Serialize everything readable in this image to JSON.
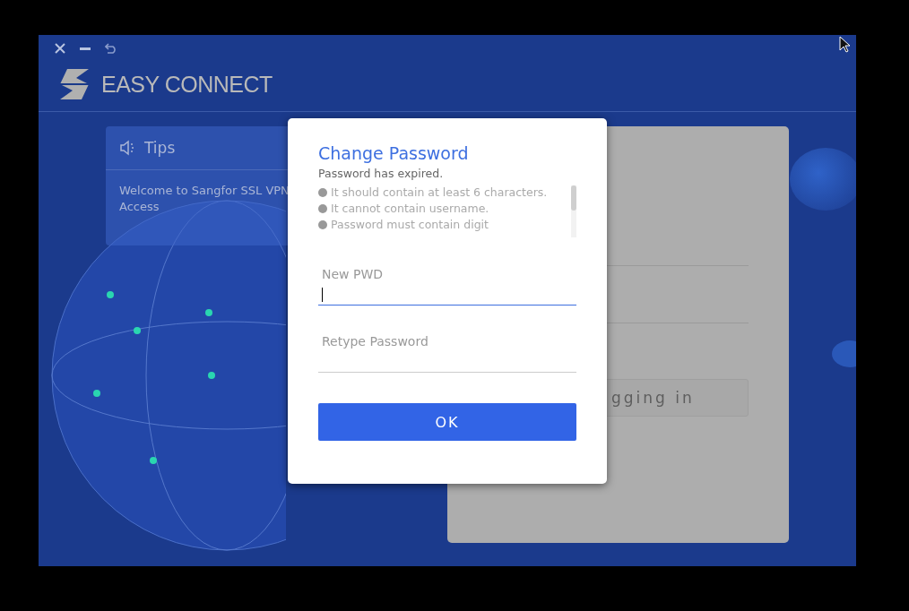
{
  "app": {
    "title": "EASY CONNECT"
  },
  "tips": {
    "title": "Tips",
    "message": "Welcome to Sangfor SSL VPN Access"
  },
  "login_panel": {
    "button": "gging in"
  },
  "dialog": {
    "title": "Change Password",
    "subtitle": "Password has expired.",
    "rules": [
      "It should contain at least 6 characters.",
      "It cannot contain username.",
      "Password must contain digit"
    ],
    "fields": [
      {
        "placeholder": "New PWD",
        "focused": true
      },
      {
        "placeholder": "Retype Password",
        "focused": false
      }
    ],
    "ok_button": "OK"
  }
}
